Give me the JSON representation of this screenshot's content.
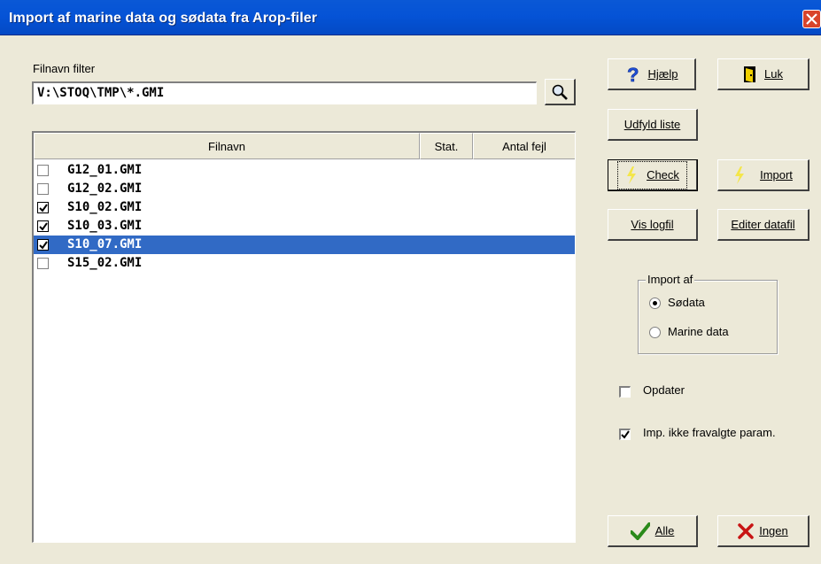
{
  "window": {
    "title": "Import af marine data og sødata fra Arop-filer"
  },
  "filter": {
    "label": "Filnavn filter",
    "value": "V:\\STOQ\\TMP\\*.GMI"
  },
  "list": {
    "columns": [
      "Filnavn",
      "Stat.",
      "Antal fejl"
    ],
    "rows": [
      {
        "name": "G12_01.GMI",
        "checked": false,
        "selected": false
      },
      {
        "name": "G12_02.GMI",
        "checked": false,
        "selected": false
      },
      {
        "name": "S10_02.GMI",
        "checked": true,
        "selected": false
      },
      {
        "name": "S10_03.GMI",
        "checked": true,
        "selected": false
      },
      {
        "name": "S10_07.GMI",
        "checked": true,
        "selected": true
      },
      {
        "name": "S15_02.GMI",
        "checked": false,
        "selected": false
      }
    ]
  },
  "buttons": {
    "help": "Hjælp",
    "close": "Luk",
    "fill_list": "Udfyld liste",
    "check": "Check",
    "import": "Import",
    "view_log": "Vis logfil",
    "edit_file": "Editer datafil",
    "all": "Alle",
    "none": "Ingen"
  },
  "import_of": {
    "legend": "Import af",
    "options": [
      {
        "label": "Sødata",
        "selected": true
      },
      {
        "label": "Marine data",
        "selected": false
      }
    ]
  },
  "options": {
    "update_label": "Opdater",
    "update_checked": false,
    "imp_label": "Imp. ikke fravalgte param.",
    "imp_checked": true
  },
  "colors": {
    "title_bar": "#0553d6",
    "selection": "#316ac5",
    "dialog_bg": "#ece9d8"
  },
  "icons": {
    "search": "magnifier-icon",
    "help": "question-icon",
    "close": "door-icon",
    "check": "lightning-icon",
    "import": "lightning-icon",
    "all": "checkmark-icon",
    "none": "x-icon"
  }
}
